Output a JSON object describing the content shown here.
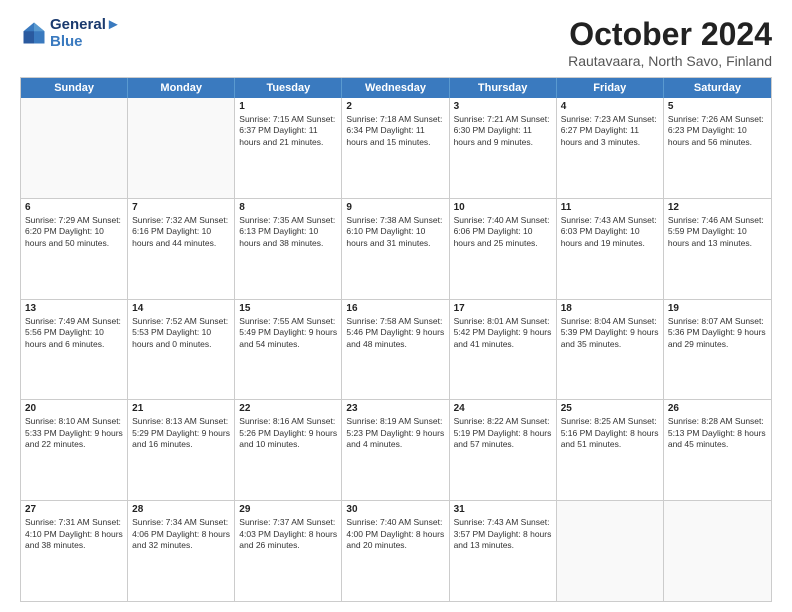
{
  "header": {
    "logo_line1": "General",
    "logo_line2": "Blue",
    "month_title": "October 2024",
    "location": "Rautavaara, North Savo, Finland"
  },
  "days_of_week": [
    "Sunday",
    "Monday",
    "Tuesday",
    "Wednesday",
    "Thursday",
    "Friday",
    "Saturday"
  ],
  "rows": [
    [
      {
        "day": "",
        "text": "",
        "empty": true
      },
      {
        "day": "",
        "text": "",
        "empty": true
      },
      {
        "day": "1",
        "text": "Sunrise: 7:15 AM\nSunset: 6:37 PM\nDaylight: 11 hours\nand 21 minutes."
      },
      {
        "day": "2",
        "text": "Sunrise: 7:18 AM\nSunset: 6:34 PM\nDaylight: 11 hours\nand 15 minutes."
      },
      {
        "day": "3",
        "text": "Sunrise: 7:21 AM\nSunset: 6:30 PM\nDaylight: 11 hours\nand 9 minutes."
      },
      {
        "day": "4",
        "text": "Sunrise: 7:23 AM\nSunset: 6:27 PM\nDaylight: 11 hours\nand 3 minutes."
      },
      {
        "day": "5",
        "text": "Sunrise: 7:26 AM\nSunset: 6:23 PM\nDaylight: 10 hours\nand 56 minutes."
      }
    ],
    [
      {
        "day": "6",
        "text": "Sunrise: 7:29 AM\nSunset: 6:20 PM\nDaylight: 10 hours\nand 50 minutes."
      },
      {
        "day": "7",
        "text": "Sunrise: 7:32 AM\nSunset: 6:16 PM\nDaylight: 10 hours\nand 44 minutes."
      },
      {
        "day": "8",
        "text": "Sunrise: 7:35 AM\nSunset: 6:13 PM\nDaylight: 10 hours\nand 38 minutes."
      },
      {
        "day": "9",
        "text": "Sunrise: 7:38 AM\nSunset: 6:10 PM\nDaylight: 10 hours\nand 31 minutes."
      },
      {
        "day": "10",
        "text": "Sunrise: 7:40 AM\nSunset: 6:06 PM\nDaylight: 10 hours\nand 25 minutes."
      },
      {
        "day": "11",
        "text": "Sunrise: 7:43 AM\nSunset: 6:03 PM\nDaylight: 10 hours\nand 19 minutes."
      },
      {
        "day": "12",
        "text": "Sunrise: 7:46 AM\nSunset: 5:59 PM\nDaylight: 10 hours\nand 13 minutes."
      }
    ],
    [
      {
        "day": "13",
        "text": "Sunrise: 7:49 AM\nSunset: 5:56 PM\nDaylight: 10 hours\nand 6 minutes."
      },
      {
        "day": "14",
        "text": "Sunrise: 7:52 AM\nSunset: 5:53 PM\nDaylight: 10 hours\nand 0 minutes."
      },
      {
        "day": "15",
        "text": "Sunrise: 7:55 AM\nSunset: 5:49 PM\nDaylight: 9 hours\nand 54 minutes."
      },
      {
        "day": "16",
        "text": "Sunrise: 7:58 AM\nSunset: 5:46 PM\nDaylight: 9 hours\nand 48 minutes."
      },
      {
        "day": "17",
        "text": "Sunrise: 8:01 AM\nSunset: 5:42 PM\nDaylight: 9 hours\nand 41 minutes."
      },
      {
        "day": "18",
        "text": "Sunrise: 8:04 AM\nSunset: 5:39 PM\nDaylight: 9 hours\nand 35 minutes."
      },
      {
        "day": "19",
        "text": "Sunrise: 8:07 AM\nSunset: 5:36 PM\nDaylight: 9 hours\nand 29 minutes."
      }
    ],
    [
      {
        "day": "20",
        "text": "Sunrise: 8:10 AM\nSunset: 5:33 PM\nDaylight: 9 hours\nand 22 minutes."
      },
      {
        "day": "21",
        "text": "Sunrise: 8:13 AM\nSunset: 5:29 PM\nDaylight: 9 hours\nand 16 minutes."
      },
      {
        "day": "22",
        "text": "Sunrise: 8:16 AM\nSunset: 5:26 PM\nDaylight: 9 hours\nand 10 minutes."
      },
      {
        "day": "23",
        "text": "Sunrise: 8:19 AM\nSunset: 5:23 PM\nDaylight: 9 hours\nand 4 minutes."
      },
      {
        "day": "24",
        "text": "Sunrise: 8:22 AM\nSunset: 5:19 PM\nDaylight: 8 hours\nand 57 minutes."
      },
      {
        "day": "25",
        "text": "Sunrise: 8:25 AM\nSunset: 5:16 PM\nDaylight: 8 hours\nand 51 minutes."
      },
      {
        "day": "26",
        "text": "Sunrise: 8:28 AM\nSunset: 5:13 PM\nDaylight: 8 hours\nand 45 minutes."
      }
    ],
    [
      {
        "day": "27",
        "text": "Sunrise: 7:31 AM\nSunset: 4:10 PM\nDaylight: 8 hours\nand 38 minutes."
      },
      {
        "day": "28",
        "text": "Sunrise: 7:34 AM\nSunset: 4:06 PM\nDaylight: 8 hours\nand 32 minutes."
      },
      {
        "day": "29",
        "text": "Sunrise: 7:37 AM\nSunset: 4:03 PM\nDaylight: 8 hours\nand 26 minutes."
      },
      {
        "day": "30",
        "text": "Sunrise: 7:40 AM\nSunset: 4:00 PM\nDaylight: 8 hours\nand 20 minutes."
      },
      {
        "day": "31",
        "text": "Sunrise: 7:43 AM\nSunset: 3:57 PM\nDaylight: 8 hours\nand 13 minutes."
      },
      {
        "day": "",
        "text": "",
        "empty": true
      },
      {
        "day": "",
        "text": "",
        "empty": true
      }
    ]
  ]
}
